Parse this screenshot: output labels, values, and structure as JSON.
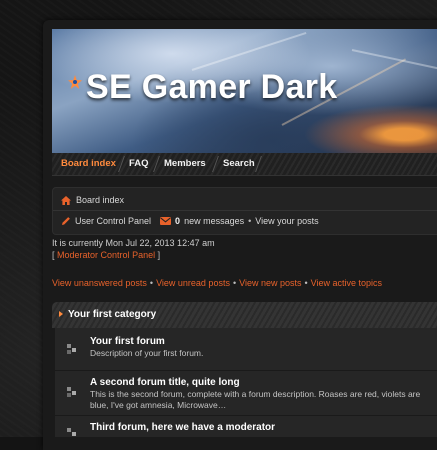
{
  "header": {
    "logo_text": "SE Gamer Dark"
  },
  "nav": {
    "items": [
      {
        "label": "Board index",
        "active": true
      },
      {
        "label": "FAQ",
        "active": false
      },
      {
        "label": "Members",
        "active": false
      },
      {
        "label": "Search",
        "active": false
      }
    ]
  },
  "breadcrumb": {
    "home_label": "Board index",
    "ucp_label": "User Control Panel",
    "messages_count": "0",
    "messages_label": "new messages",
    "separator": "•",
    "view_posts_label": "View your posts"
  },
  "status": {
    "current_time": "It is currently Mon Jul 22, 2013 12:47 am",
    "bracket_open": "[",
    "mcp_label": "Moderator Control Panel",
    "bracket_close": "]"
  },
  "quick_links": {
    "unanswered": "View unanswered posts",
    "unread": "View unread posts",
    "new": "View new posts",
    "active": "View active topics",
    "separator": "•"
  },
  "category": {
    "title": "Your first category",
    "forums": [
      {
        "title": "Your first forum",
        "description": "Description of your first forum."
      },
      {
        "title": "A second forum title, quite long",
        "description": "This is the second forum, complete with a forum description. Roases are red, violets are blue, I've got amnesia, Microwave…"
      },
      {
        "title": "Third forum, here we have a moderator",
        "description": ""
      }
    ]
  },
  "colors": {
    "accent": "#ff8a3d",
    "link": "#e8622b",
    "background": "#141414"
  }
}
